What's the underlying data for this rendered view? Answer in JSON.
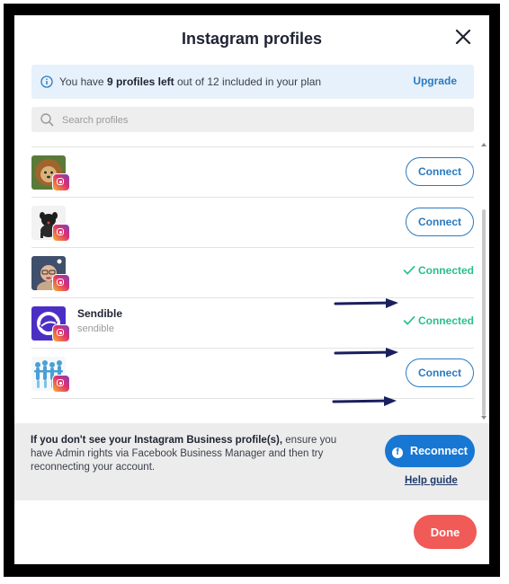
{
  "modal": {
    "title": "Instagram profiles",
    "close_icon": "close-icon"
  },
  "info": {
    "icon": "info-icon",
    "text_before": "You have",
    "profiles_left": "9 profiles left",
    "text_after": "out of 12 included in your plan",
    "upgrade_label": "Upgrade"
  },
  "search": {
    "icon": "search-icon",
    "placeholder": "Search profiles",
    "value": ""
  },
  "profiles": [
    {
      "name": "",
      "handle": "",
      "status": "connect",
      "action_label": "Connect",
      "avatar": "lion-dog-photo"
    },
    {
      "name": "",
      "handle": "",
      "status": "connect",
      "action_label": "Connect",
      "avatar": "black-dog-photo"
    },
    {
      "name": "",
      "handle": "",
      "status": "connected",
      "action_label": "Connected",
      "avatar": "person-glasses-photo"
    },
    {
      "name": "Sendible",
      "handle": "sendible",
      "status": "connected",
      "action_label": "Connected",
      "avatar": "sendible-logo"
    },
    {
      "name": "",
      "handle": "",
      "status": "connect",
      "action_label": "Connect",
      "avatar": "people-chain-graphic"
    }
  ],
  "footer": {
    "bold_text": "If you don't see your Instagram Business profile(s),",
    "text": "ensure you have Admin rights via Facebook Business Manager and then try reconnecting your account.",
    "reconnect_label": "Reconnect",
    "help_label": "Help guide"
  },
  "done_label": "Done",
  "colors": {
    "accent": "#2a7ac0",
    "connected": "#2bbf8a",
    "facebook": "#1877d2",
    "done": "#f05a57",
    "annotation_arrow": "#1a1f5e"
  }
}
